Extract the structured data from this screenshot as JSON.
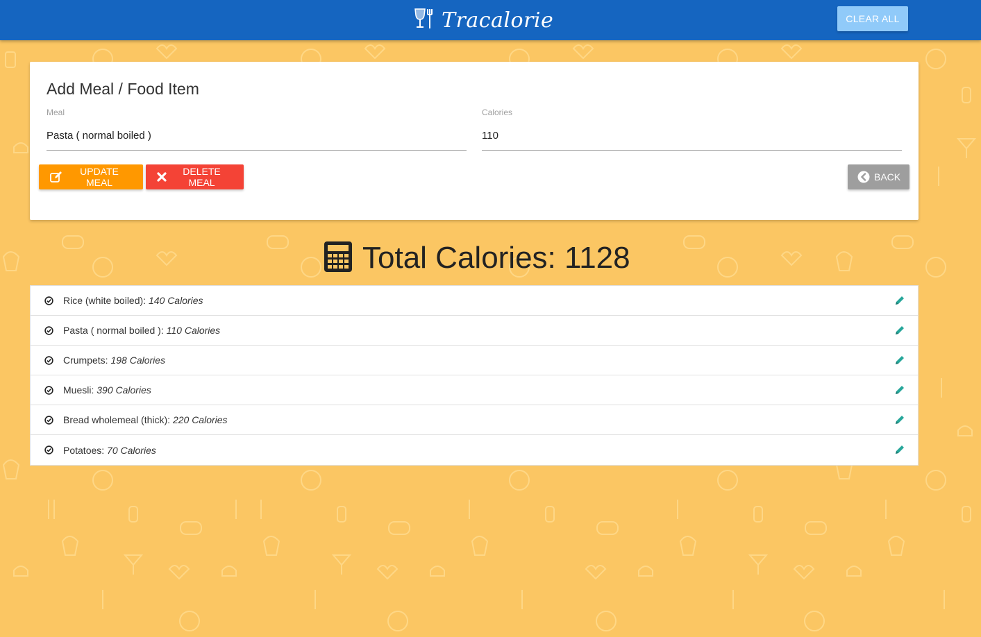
{
  "app": {
    "brand": "Tracalorie",
    "clear_all_label": "CLEAR ALL"
  },
  "form": {
    "title": "Add Meal / Food Item",
    "meal_label": "Meal",
    "meal_value": "Pasta ( normal boiled )",
    "calories_label": "Calories",
    "calories_value": "110",
    "update_label": "UPDATE MEAL",
    "delete_label": "DELETE MEAL",
    "back_label": "BACK"
  },
  "total": {
    "text": "Total Calories: 1128"
  },
  "items": [
    {
      "name": "Rice (white boiled):",
      "calories": "140 Calories"
    },
    {
      "name": "Pasta ( normal boiled ):",
      "calories": "110 Calories"
    },
    {
      "name": "Crumpets:",
      "calories": "198 Calories"
    },
    {
      "name": "Muesli:",
      "calories": "390 Calories"
    },
    {
      "name": "Bread wholemeal (thick):",
      "calories": "220 Calories"
    },
    {
      "name": "Potatoes:",
      "calories": "70 Calories"
    }
  ],
  "colors": {
    "navbar": "#1565c0",
    "background": "#fbc663",
    "update": "#ff9800",
    "delete": "#f44336",
    "back": "#9e9e9e",
    "edit_icon": "#26a69a"
  },
  "icons": {
    "brand": "glass-fork-icon",
    "update": "edit-square-icon",
    "delete": "times-icon",
    "back": "chevron-circle-left-icon",
    "total": "calculator-icon",
    "item": "check-circle-icon",
    "item_action": "pencil-icon"
  }
}
